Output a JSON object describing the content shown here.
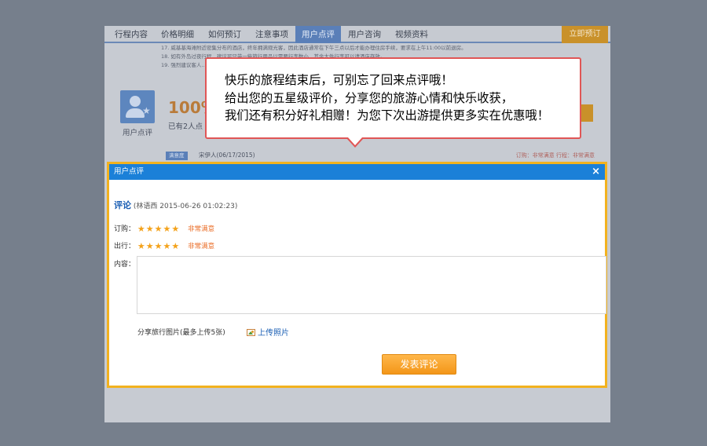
{
  "background_page": {
    "tabs": [
      {
        "label": "行程内容",
        "active": false
      },
      {
        "label": "价格明细",
        "active": false
      },
      {
        "label": "如何预订",
        "active": false
      },
      {
        "label": "注意事项",
        "active": false
      },
      {
        "label": "用户点评",
        "active": true
      },
      {
        "label": "用户咨询",
        "active": false
      },
      {
        "label": "视频资料",
        "active": false
      }
    ],
    "book_now": "立即预订",
    "notes": [
      "17. 威基基海滩附近密集分布的酒店，终年拥满观光客，因此酒店通常在下午三点以后才能办理住房手续，要求在上午11:00以前退房。",
      "18. 如有外岛过夜行程，建议可只带一些旅行用品以需要行李数小，其余大件行李可以请酒店存放。",
      "19. 强烈建议客人……"
    ],
    "user_review_label": "用户点评",
    "satisfaction_pct": "100%",
    "review_count_text": "已有2人点",
    "satisfaction_badge": "满意度",
    "reviewer_line": "宋伊人(06/17/2015)",
    "right_ratings": "订购：非常满意   行程：非常满意"
  },
  "callout": {
    "lines": [
      "快乐的旅程结束后，可别忘了回来点评哦！",
      "给出您的五星级评价，分享您的旅游心情和快乐收获，",
      "我们还有积分好礼相赠！为您下次出游提供更多实在优惠哦！"
    ]
  },
  "modal": {
    "title": "用户点评",
    "close": "×",
    "review_label": "评论",
    "reviewer_info": "(林语西 2015-06-26 01:02:23)",
    "ratings": [
      {
        "label": "订购：",
        "stars": "★★★★★",
        "stars_value": 5,
        "text": "非常满意"
      },
      {
        "label": "出行：",
        "stars": "★★★★★",
        "stars_value": 5,
        "text": "非常满意"
      }
    ],
    "content_label": "内容：",
    "content_value": "",
    "upload_hint": "分享旅行图片(最多上传5张)",
    "upload_link": "上传照片",
    "submit": "发表评论"
  },
  "colors": {
    "modal_header": "#1b80d8",
    "modal_border": "#f2b21f",
    "callout_border": "#e05656",
    "star": "#f4a21a",
    "rating_text": "#ea6b24",
    "submit_button": "#f39619"
  },
  "icons": [
    "close-icon",
    "star-icon",
    "image-icon",
    "user-icon"
  ]
}
